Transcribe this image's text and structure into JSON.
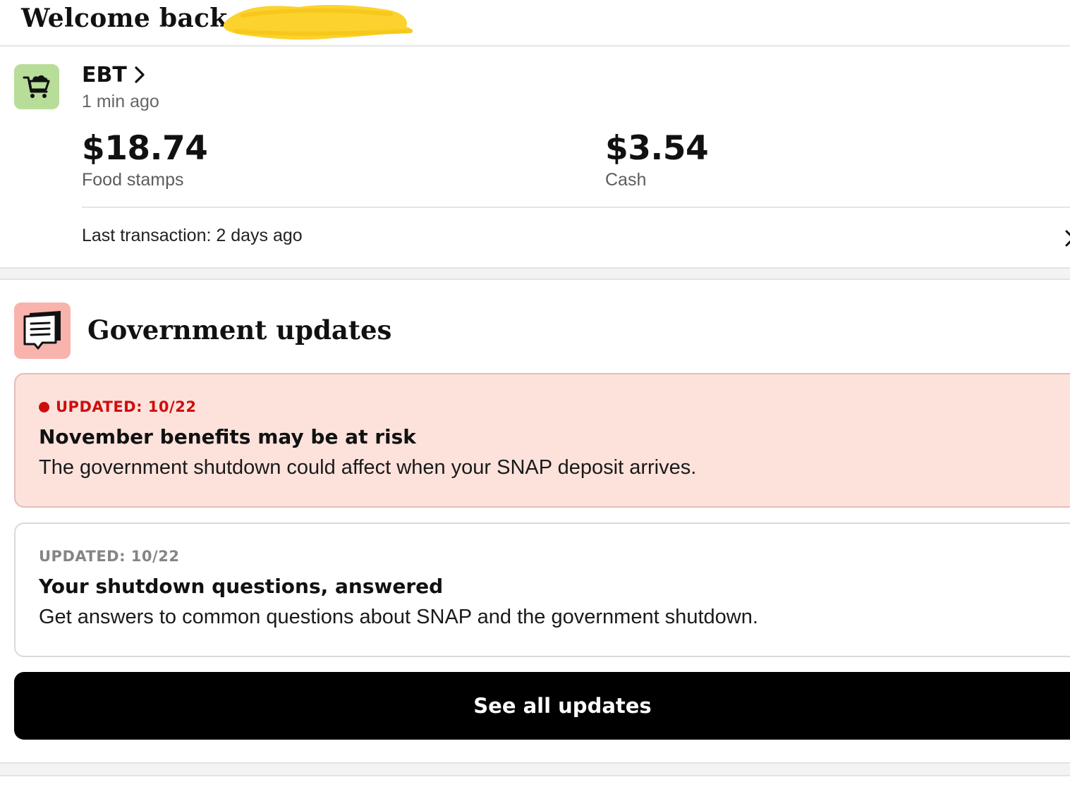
{
  "header": {
    "welcome_text": "Welcome back,",
    "redaction_color": "#fcd22e"
  },
  "ebt": {
    "title": "EBT",
    "updated": "1 min ago",
    "icon": "shopping-cart-icon",
    "icon_bg": "#b7dd98",
    "balances": [
      {
        "amount": "$18.74",
        "label": "Food stamps"
      },
      {
        "amount": "$3.54",
        "label": "Cash"
      }
    ],
    "last_transaction": "Last transaction: 2 days ago"
  },
  "government_updates": {
    "title": "Government updates",
    "icon": "notice-document-icon",
    "icon_bg": "#f8b3ad",
    "cards": [
      {
        "tag": "UPDATED: 10/22",
        "tag_color": "#cf0e0e",
        "heading": "November benefits may be at risk",
        "body": "The government shutdown could affect when your SNAP deposit arrives."
      },
      {
        "tag": "UPDATED: 10/22",
        "tag_color": "#858585",
        "heading": "Your shutdown questions, answered",
        "body": "Get answers to common questions about SNAP and the government shutdown."
      }
    ],
    "see_all_label": "See all updates"
  }
}
